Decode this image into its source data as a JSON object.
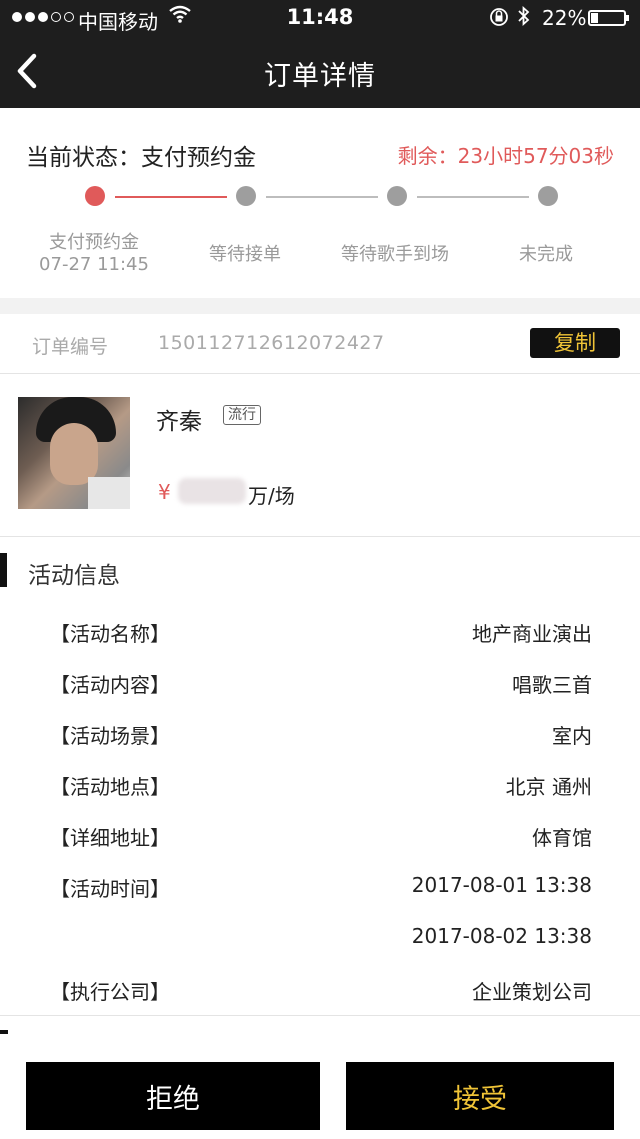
{
  "status_bar": {
    "carrier": "中国移动",
    "time": "11:48",
    "battery_percent": "22%",
    "battery_level": 0.22,
    "icons": [
      "signal-dots",
      "wifi-icon",
      "rotation-lock-icon",
      "bluetooth-icon",
      "battery-icon"
    ]
  },
  "nav": {
    "title": "订单详情",
    "back_icon": "chevron-left-icon"
  },
  "order_status": {
    "label": "当前状态：支付预约金",
    "remaining": "剩余：23小时57分03秒",
    "steps": [
      {
        "label": "支付预约金",
        "time": "07-27 11:45",
        "active": true
      },
      {
        "label": "等待接单",
        "time": "",
        "active": false
      },
      {
        "label": "等待歌手到场",
        "time": "",
        "active": false
      },
      {
        "label": "未完成",
        "time": "",
        "active": false
      }
    ]
  },
  "order": {
    "number_label": "订单编号",
    "number": "150112712612072427",
    "copy_label": "复制"
  },
  "singer": {
    "name": "齐秦",
    "genre": "流行",
    "price_currency": "¥",
    "price_unit": "万/场"
  },
  "activity": {
    "section_title": "活动信息",
    "rows": [
      {
        "key": "【活动名称】",
        "value": "地产商业演出"
      },
      {
        "key": "【活动内容】",
        "value": "唱歌三首"
      },
      {
        "key": "【活动场景】",
        "value": "室内"
      },
      {
        "key": "【活动地点】",
        "value": "北京 通州"
      },
      {
        "key": "【详细地址】",
        "value": "体育馆"
      },
      {
        "key": "【活动时间】",
        "value": "2017-08-01 13:38"
      },
      {
        "key": "",
        "value": "2017-08-02 13:38"
      },
      {
        "key": "【执行公司】",
        "value": "企业策划公司"
      }
    ]
  },
  "actions": {
    "reject_label": "拒绝",
    "accept_label": "接受"
  },
  "colors": {
    "accent_red": "#e05a5a",
    "gold": "#f0c437",
    "bar_dark": "#1e1e1e"
  }
}
